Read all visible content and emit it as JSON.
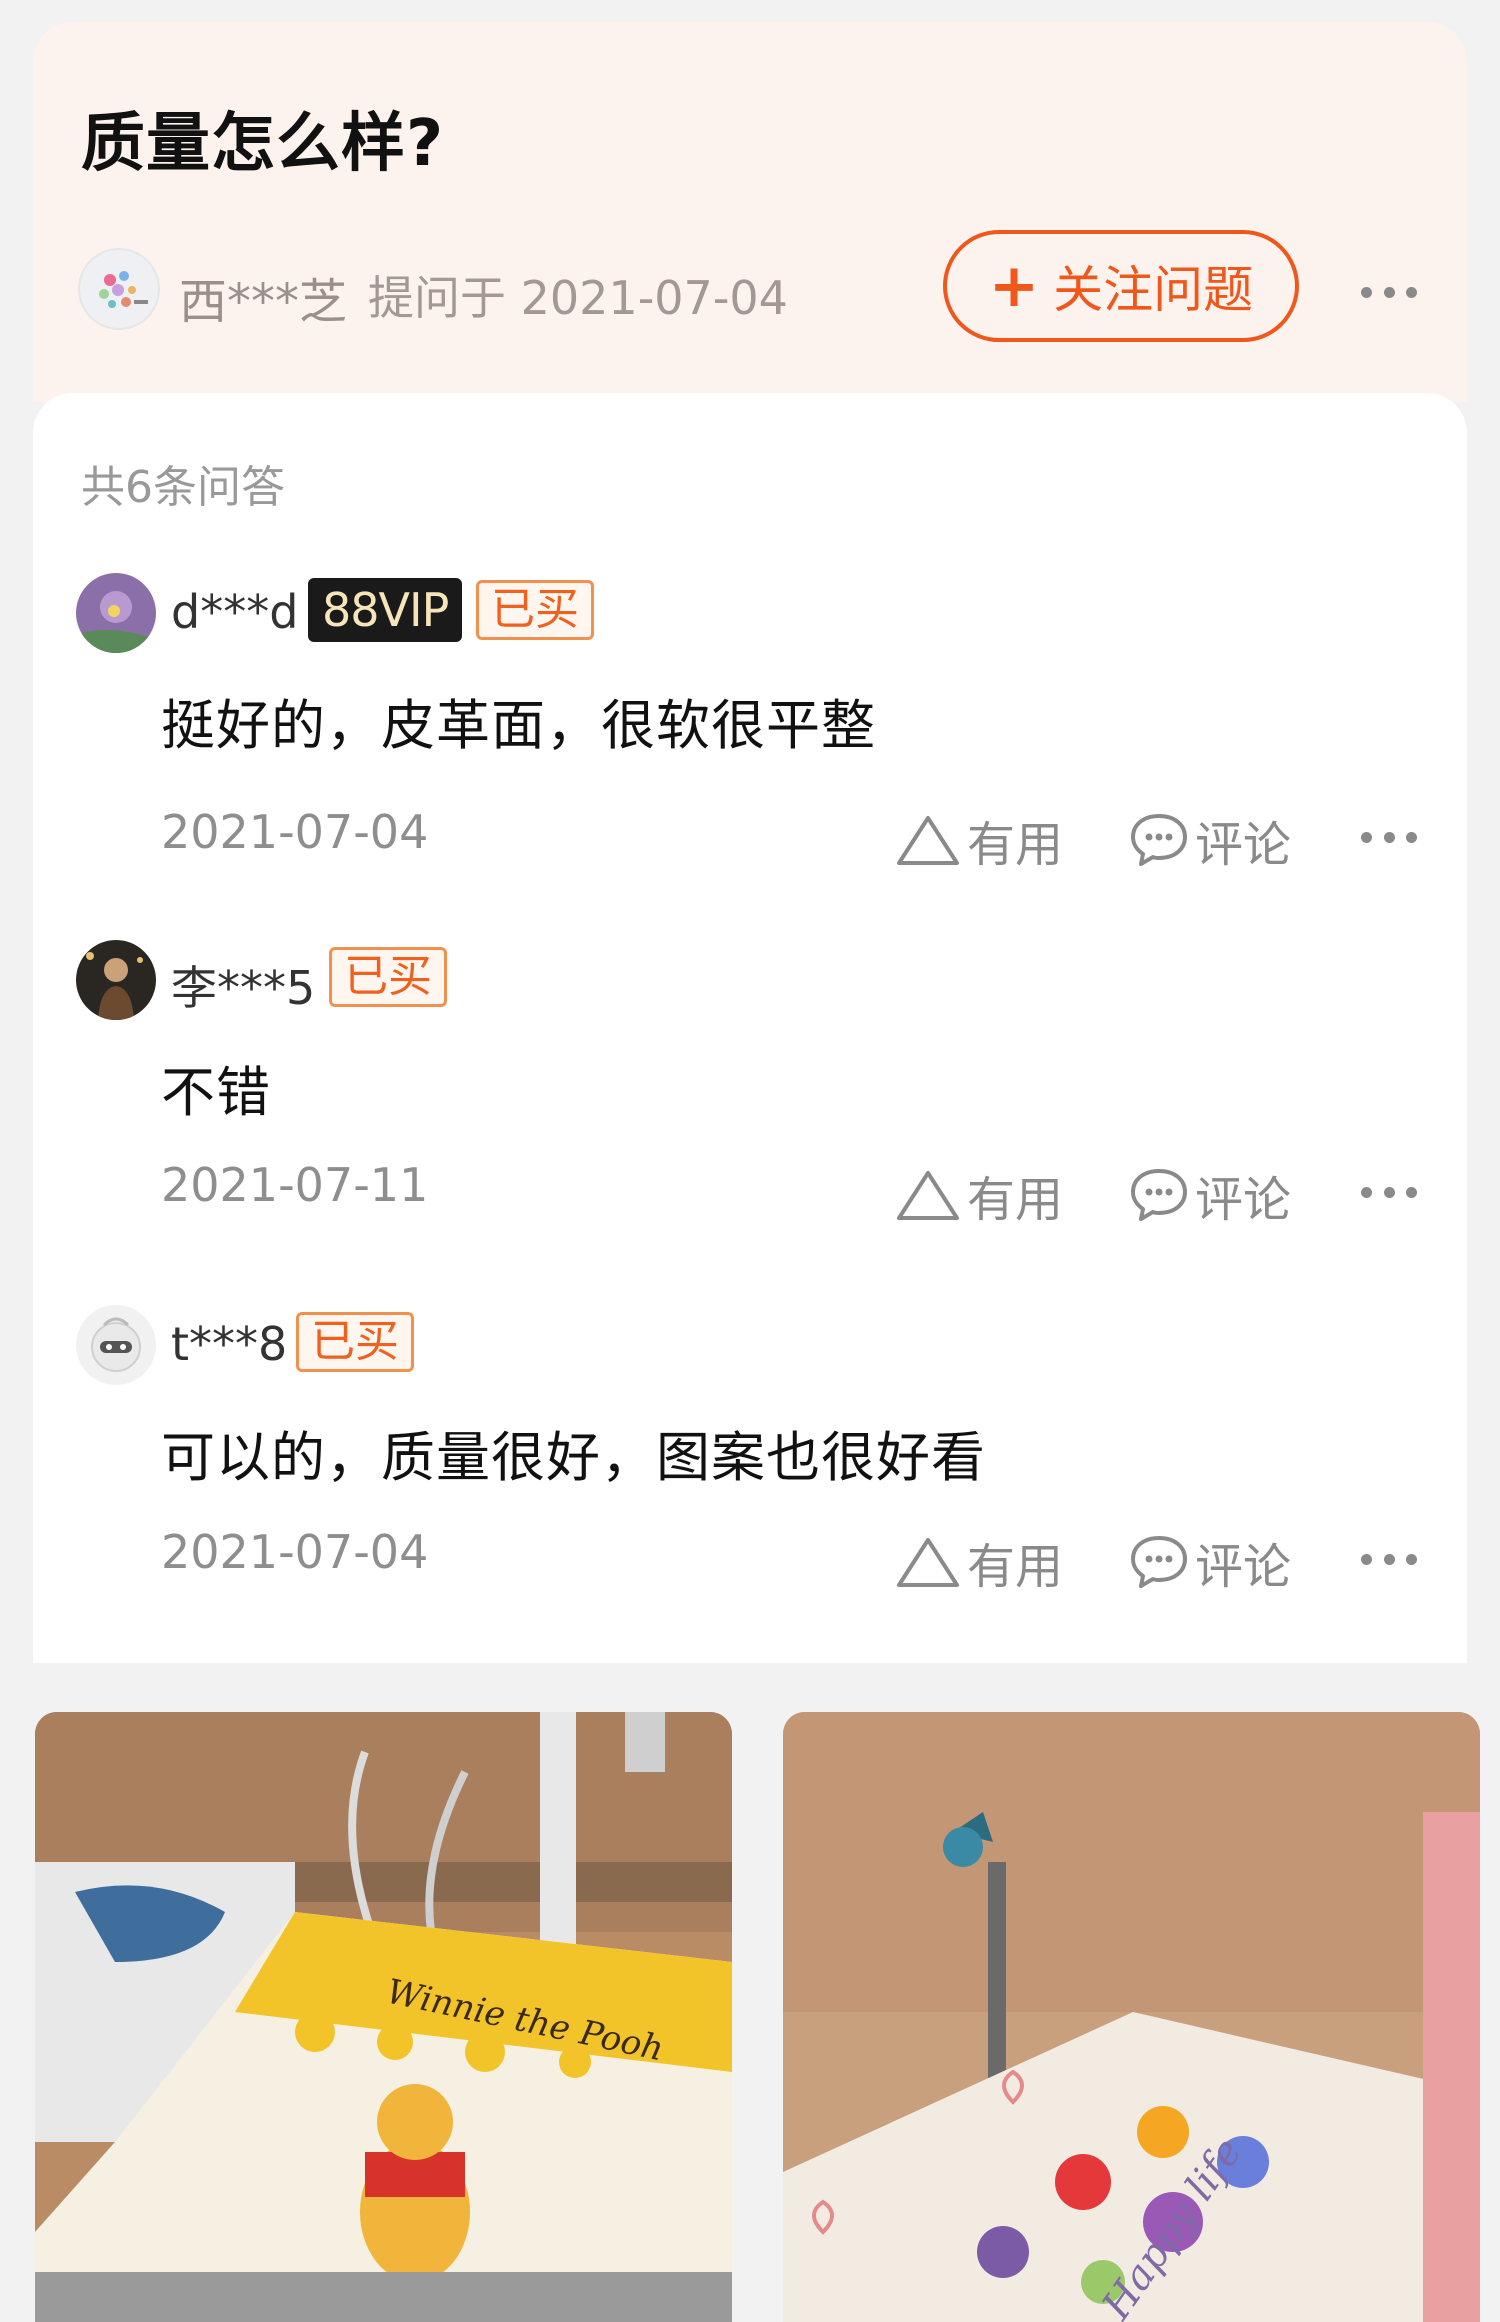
{
  "question": {
    "title": "质量怎么样?",
    "asker_name": "西***芝",
    "asked_meta": "提问于 2021-07-04",
    "follow_label": "关注问题"
  },
  "answers_header": {
    "count_text": "共6条问答"
  },
  "answers": [
    {
      "username": "d***d",
      "vip_badge": "88VIP",
      "bought_badge": "已买",
      "content": "挺好的，皮革面，很软很平整",
      "date": "2021-07-04",
      "useful_label": "有用",
      "comment_label": "评论"
    },
    {
      "username": "李***5",
      "bought_badge": "已买",
      "content": "不错",
      "date": "2021-07-11",
      "useful_label": "有用",
      "comment_label": "评论"
    },
    {
      "username": "t***8",
      "bought_badge": "已买",
      "content": "可以的，质量很好，图案也很好看",
      "date": "2021-07-04",
      "useful_label": "有用",
      "comment_label": "评论"
    }
  ],
  "photos": [
    {
      "caption": "Winnie the Pooh"
    },
    {
      "caption": "Happy life"
    }
  ],
  "colors": {
    "accent": "#f0571b",
    "question_bg": "#fdf3ee",
    "bought_badge": "#f0601e",
    "vip_badge_bg": "#1a1a1a"
  },
  "icons": [
    "plus-icon",
    "more-dots-icon",
    "triangle-useful-icon",
    "comment-bubble-icon"
  ]
}
